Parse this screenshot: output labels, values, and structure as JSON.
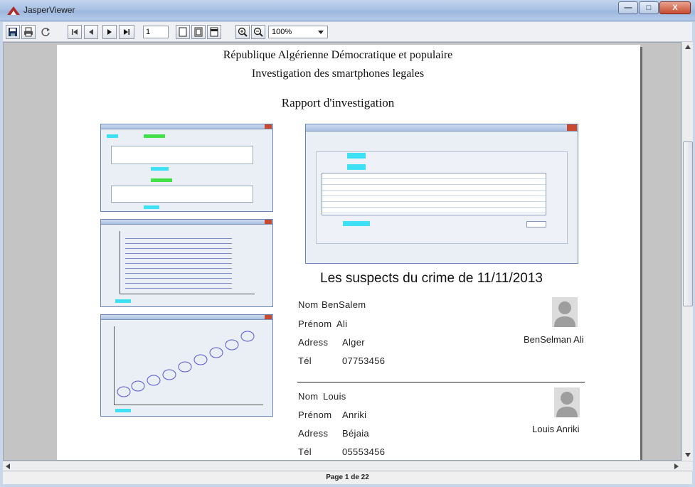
{
  "window": {
    "title": "JasperViewer"
  },
  "toolbar": {
    "page_number": "1",
    "zoom": "100%"
  },
  "report": {
    "line1": "République Algérienne  Démocratique et populaire",
    "line2": "Investigation des smartphones legales",
    "line3": "Rapport d'investigation",
    "suspects_title": "Les suspects du crime de 11/11/2013"
  },
  "suspects": [
    {
      "nom_label": "Nom",
      "nom": "BenSalem",
      "prenom_label": "Prénom",
      "prenom": "Ali",
      "adress_label": "Adress",
      "adress": "Alger",
      "tel_label": "Tél",
      "tel": "07753456",
      "caption": "BenSelman Ali"
    },
    {
      "nom_label": "Nom",
      "nom": "Louis",
      "prenom_label": "Prénom",
      "prenom": "Anriki",
      "adress_label": "Adress",
      "adress": "Béjaia",
      "tel_label": "Tél",
      "tel": "05553456",
      "caption": "Louis Anriki"
    }
  ],
  "status": {
    "page_label": "Page 1 de 22"
  },
  "colors": {
    "accent_cyan": "#3ee0f5",
    "accent_green": "#43e04a",
    "title_bar": "#a9c1e4"
  },
  "icons": [
    "save-icon",
    "print-icon",
    "reload-icon",
    "first-page-icon",
    "prev-page-icon",
    "next-page-icon",
    "last-page-icon",
    "actual-size-icon",
    "fit-page-icon",
    "fit-width-icon",
    "zoom-in-icon",
    "zoom-out-icon",
    "user-silhouette-icon"
  ]
}
